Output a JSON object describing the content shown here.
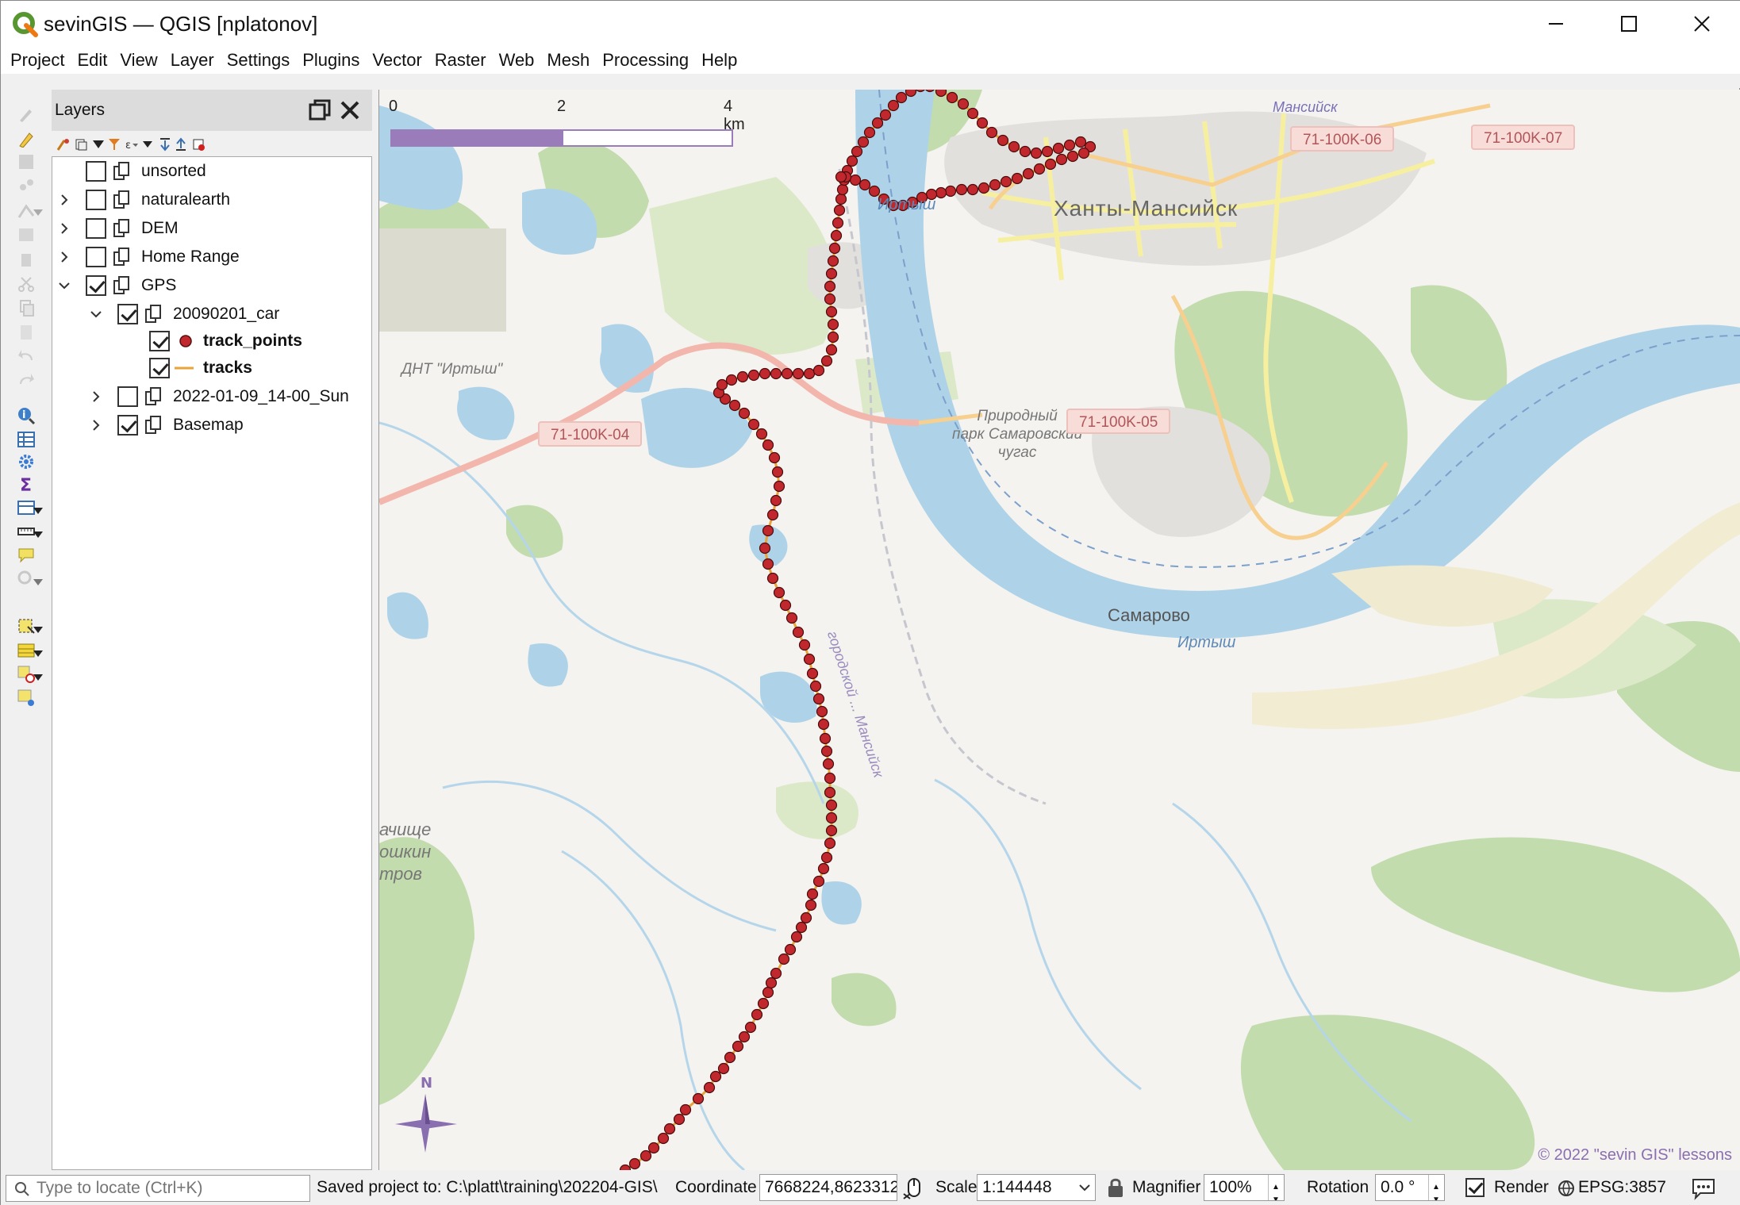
{
  "window": {
    "title": "sevinGIS — QGIS [nplatonov]",
    "minimize_icon": "minimize-icon",
    "maximize_icon": "maximize-icon",
    "close_icon": "close-icon"
  },
  "menu": [
    "Project",
    "Edit",
    "View",
    "Layer",
    "Settings",
    "Plugins",
    "Vector",
    "Raster",
    "Web",
    "Mesh",
    "Processing",
    "Help"
  ],
  "layers_panel": {
    "title": "Layers",
    "layers": [
      {
        "name": "unsorted",
        "checked": false,
        "expandable": false,
        "type": "group"
      },
      {
        "name": "naturalearth",
        "checked": false,
        "expandable": true,
        "type": "group"
      },
      {
        "name": "DEM",
        "checked": false,
        "expandable": true,
        "type": "group"
      },
      {
        "name": "Home Range",
        "checked": false,
        "expandable": true,
        "type": "group"
      },
      {
        "name": "GPS",
        "checked": true,
        "expandable": true,
        "expanded": true,
        "type": "group"
      },
      {
        "name": "20090201_car",
        "checked": true,
        "expandable": true,
        "expanded": true,
        "type": "group"
      },
      {
        "name": "track_points",
        "checked": true,
        "type": "point",
        "symbol_color": "#c0282d"
      },
      {
        "name": "tracks",
        "checked": true,
        "type": "line",
        "symbol_color": "#e8a33a"
      },
      {
        "name": "2022-01-09_14-00_Sun",
        "checked": false,
        "expandable": true,
        "type": "group"
      },
      {
        "name": "Basemap",
        "checked": true,
        "expandable": true,
        "type": "group"
      }
    ]
  },
  "map": {
    "scalebar": {
      "ticks": [
        "0",
        "2",
        "4 km"
      ],
      "color": "#9b7cba"
    },
    "north_label": "N",
    "copyright": "© 2022 \"sevin GIS\" lessons",
    "labels": {
      "irtysh1": "Иртыш",
      "irtysh2": "Иртыш",
      "city": "Ханты-Мансийск",
      "samarovo": "Самарово",
      "dnt": "ДНТ \"Иртыш\"",
      "park": "Природный\nпарк Самаровский\nчугас",
      "mansiysk_edge": "Мансийск",
      "road_vertical": "городской ... Мансийск",
      "left_edge_1": "ачище",
      "left_edge_2": "ошкин",
      "left_edge_3": "тров"
    },
    "road_shields": [
      "71-100K-04",
      "71-100K-05",
      "71-100K-06",
      "71-100K-07"
    ],
    "colors": {
      "water": "#aed3e8",
      "forest": "#b9d7a3",
      "urban": "#dcdcdc",
      "track_point": "#c0282d",
      "track_line": "#e8a33a"
    }
  },
  "statusbar": {
    "locate_placeholder": "Type to locate (Ctrl+K)",
    "message": "Saved project to: C:\\platt\\training\\202204-GIS\\",
    "coordinate_label": "Coordinate",
    "coordinate_value": "7668224,8623312",
    "scale_label": "Scale",
    "scale_value": "1:144448",
    "magnifier_label": "Magnifier",
    "magnifier_value": "100%",
    "rotation_label": "Rotation",
    "rotation_value": "0.0 °",
    "render_label": "Render",
    "render_checked": true,
    "crs": "EPSG:3857"
  }
}
